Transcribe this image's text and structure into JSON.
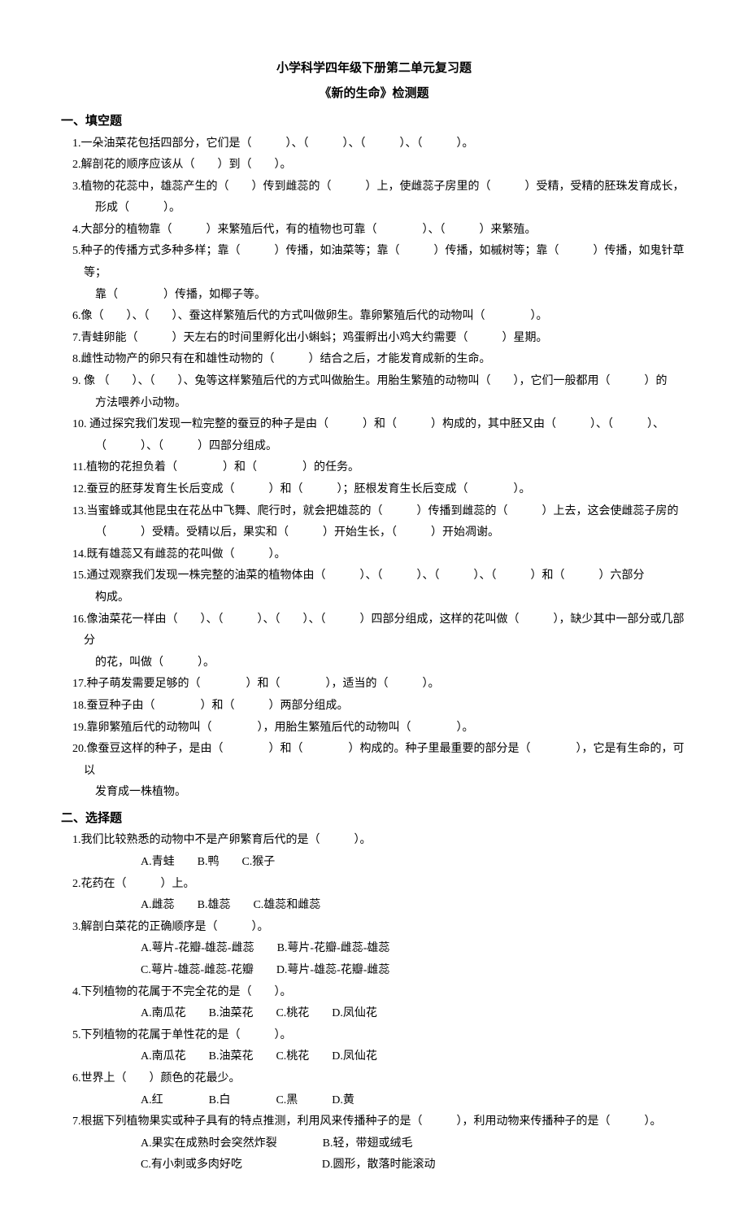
{
  "title_main": "小学科学四年级下册第二单元复习题",
  "title_sub": "《新的生命》检测题",
  "section1_heading": "一、填空题",
  "fill": {
    "q1": "1.一朵油菜花包括四部分，它们是（　　　）、（　　　）、（　　　）、（　　　）。",
    "q2": "2.解剖花的顺序应该从（　　）到（　　）。",
    "q3": "3.植物的花蕊中，雄蕊产生的（　　）传到雌蕊的（　　　）上，使雌蕊子房里的（　　　）受精，受精的胚珠发育成长，",
    "q3_cont": "形成（　　　）。",
    "q4": "4.大部分的植物靠（　　　）来繁殖后代，有的植物也可靠（　　　　）、（　　　）来繁殖。",
    "q5": "5.种子的传播方式多种多样；靠（　　　）传播，如油菜等；靠（　　　）传播，如槭树等；靠（　　　）传播，如鬼针草等；",
    "q5_cont": "靠（　　　　）传播，如椰子等。",
    "q6": "6.像（　　）、（　　）、蚕这样繁殖后代的方式叫做卵生。靠卵繁殖后代的动物叫（　　　　）。",
    "q7": "7.青蛙卵能（　　　）天左右的时间里孵化出小蝌蚪；鸡蛋孵出小鸡大约需要（　　　）星期。",
    "q8": "8.雌性动物产的卵只有在和雄性动物的（　　　）结合之后，才能发育成新的生命。",
    "q9": "9. 像 （　　）、（　　）、兔等这样繁殖后代的方式叫做胎生。用胎生繁殖的动物叫（　　），它们一般都用（　　　）的",
    "q9_cont": "方法喂养小动物。",
    "q10": "10. 通过探究我们发现一粒完整的蚕豆的种子是由（　　　）和（　　　）构成的，其中胚又由（　　　）、（　　　）、",
    "q10_cont": "（　　　）、（　　　）四部分组成。",
    "q11": "11.植物的花担负着（　　　　）和（　　　　）的任务。",
    "q12": "12.蚕豆的胚芽发育生长后变成（　　　）和（　　　）；胚根发育生长后变成（　　　　）。",
    "q13": "13.当蜜蜂或其他昆虫在花丛中飞舞、爬行时，就会把雄蕊的（　　　）传播到雌蕊的（　　　）上去，这会使雌蕊子房的",
    "q13_cont": "（　　　）受精。受精以后，果实和（　　　）开始生长，（　　　）开始凋谢。",
    "q14": "14.既有雄蕊又有雌蕊的花叫做（　　　）。",
    "q15": "15.通过观察我们发现一株完整的油菜的植物体由（　　　）、（　　　）、（　　　）、（　　　）和（　　　）六部分",
    "q15_cont": "构成。",
    "q16": "16.像油菜花一样由（　　）、（　　　）、（　　）、（　　　）四部分组成，这样的花叫做（　　　），缺少其中一部分或几部分",
    "q16_cont": "的花，叫做（　　　）。",
    "q17": "17.种子萌发需要足够的（　　　　）和（　　　　），适当的（　　　）。",
    "q18": "18.蚕豆种子由（　　　　）和（　　　）两部分组成。",
    "q19": "19.靠卵繁殖后代的动物叫（　　　　），用胎生繁殖后代的动物叫（　　　　）。",
    "q20": "20.像蚕豆这样的种子，是由（　　　　）和（　　　　）构成的。种子里最重要的部分是（　　　　），它是有生命的，可以",
    "q20_cont": "发育成一株植物。"
  },
  "section2_heading": "二、选择题",
  "choice": {
    "q1": "1.我们比较熟悉的动物中不是产卵繁育后代的是（　　　）。",
    "q1_opts": "A.青蛙　　B.鸭　　C.猴子",
    "q2": "2.花药在（　　　）上。",
    "q2_opts": "A.雌蕊　　B.雄蕊　　C.雄蕊和雌蕊",
    "q3": "3.解剖白菜花的正确顺序是（　　　）。",
    "q3_opts1": "A.萼片-花瓣-雄蕊-雌蕊　　B.萼片-花瓣-雌蕊-雄蕊",
    "q3_opts2": "C.萼片-雄蕊-雌蕊-花瓣　　D.萼片-雄蕊-花瓣-雌蕊",
    "q4": "4.下列植物的花属于不完全花的是（　　）。",
    "q4_opts": "A.南瓜花　　B.油菜花　　C.桃花　　D.凤仙花",
    "q5": "5.下列植物的花属于单性花的是（　　　）。",
    "q5_opts": "A.南瓜花　　B.油菜花　　C.桃花　　D.凤仙花",
    "q6": "6.世界上（　　）颜色的花最少。",
    "q6_opts": "A.红　　　　B.白　　　　C.黑　　　D.黄",
    "q7": "7.根据下列植物果实或种子具有的特点推测，利用风来传播种子的是（　　　），利用动物来传播种子的是（　　　）。",
    "q7_opts1": "A.果实在成熟时会突然炸裂　　　　B.轻，带翅或绒毛",
    "q7_opts2": "C.有小刺或多肉好吃　　　　　　　D.圆形，散落时能滚动"
  }
}
